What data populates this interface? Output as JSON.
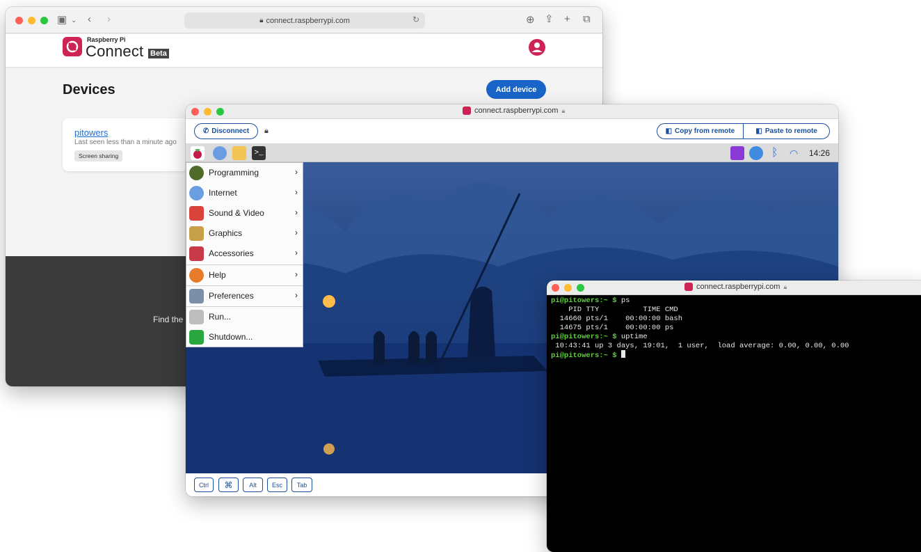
{
  "browser": {
    "url": "connect.raspberrypi.com",
    "brand_small": "Raspberry Pi",
    "brand_big": "Connect",
    "beta_label": "Beta",
    "page_title": "Devices",
    "add_device_label": "Add device",
    "device": {
      "name": "pitowers",
      "last_seen": "Last seen less than a minute ago",
      "tag": "Screen sharing"
    },
    "footer_text": "Find the"
  },
  "remote": {
    "title_url": "connect.raspberrypi.com",
    "disconnect_label": "Disconnect",
    "copy_label": "Copy from remote",
    "paste_label": "Paste to remote",
    "clock": "14:26",
    "menu": [
      {
        "label": "Programming",
        "arrow": "›",
        "color": "#4f6b2a"
      },
      {
        "label": "Internet",
        "arrow": "›",
        "color": "#6a9ee0"
      },
      {
        "label": "Sound & Video",
        "arrow": "›",
        "color": "#d9443c"
      },
      {
        "label": "Graphics",
        "arrow": "›",
        "color": "#c8a04a"
      },
      {
        "label": "Accessories",
        "arrow": "›",
        "color": "#c83a4a"
      },
      {
        "label": "Help",
        "arrow": "›",
        "color": "#e87a2c"
      },
      {
        "label": "Preferences",
        "arrow": "›",
        "color": "#7b8fa8"
      },
      {
        "label": "Run...",
        "arrow": "",
        "color": "#9a9a9a"
      },
      {
        "label": "Shutdown...",
        "arrow": "",
        "color": "#2aa640"
      }
    ],
    "keys": [
      "Ctrl",
      "⌘",
      "Alt",
      "Esc",
      "Tab"
    ]
  },
  "terminal": {
    "title_url": "connect.raspberrypi.com",
    "prompt": "pi@pitowers:~ $ ",
    "cmd1": "ps",
    "ps_header": "    PID TTY          TIME CMD",
    "ps_row1": "  14660 pts/1    00:00:00 bash",
    "ps_row2": "  14675 pts/1    00:00:00 ps",
    "cmd2": "uptime",
    "uptime_out": " 10:43:41 up 3 days, 19:01,  1 user,  load average: 0.00, 0.00, 0.00"
  },
  "colors": {
    "brand": "#cd2355",
    "accent_blue": "#1864c8",
    "link_blue": "#1a4f9c"
  }
}
